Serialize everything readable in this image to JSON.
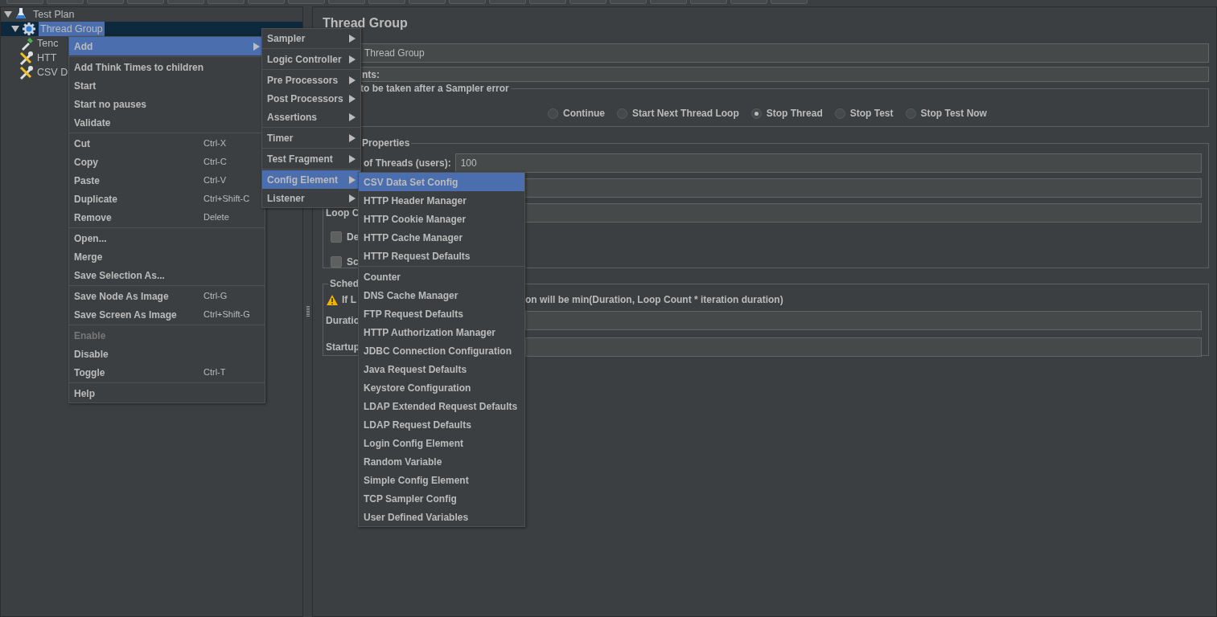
{
  "tree": [
    {
      "label": "Test Plan",
      "kind": "plan",
      "expanded": true,
      "selected": false,
      "children": [
        {
          "label": "Thread Group",
          "kind": "threads",
          "expanded": true,
          "selected": true,
          "children": [
            {
              "label": "Tenc",
              "kind": "dropper",
              "selected": false
            },
            {
              "label": "HTT",
              "kind": "tool",
              "selected": false
            },
            {
              "label": "CSV D",
              "kind": "tool",
              "selected": false
            }
          ]
        }
      ]
    }
  ],
  "editor": {
    "title": "Thread Group",
    "name_value": "Thread Group",
    "comments_label": "nts:",
    "error_action": {
      "legend": "to be taken after a Sampler error",
      "options": [
        {
          "label": "Continue",
          "selected": false
        },
        {
          "label": "Start Next Thread Loop",
          "selected": false
        },
        {
          "label": "Stop Thread",
          "selected": true
        },
        {
          "label": "Stop Test",
          "selected": false
        },
        {
          "label": "Stop Test Now",
          "selected": false
        }
      ]
    },
    "thread_properties": {
      "legend": "Properties",
      "threads_label": "of Threads (users):",
      "threads_value": "100",
      "loop_label": "Loop C",
      "checkboxes": [
        {
          "label": "De",
          "checked": false
        },
        {
          "label": "Sc",
          "checked": false
        }
      ]
    },
    "scheduler": {
      "legend": "Sched",
      "warning_start": "If L",
      "warning_end": "on will be min(Duration, Loop Count * iteration duration)",
      "fields": [
        {
          "label": "Duratio"
        },
        {
          "label": "Startup"
        }
      ]
    }
  },
  "context_menu": {
    "groups": [
      [
        {
          "label": "Add",
          "submenu": true,
          "selected": true,
          "disabled": false
        }
      ],
      [
        {
          "label": "Add Think Times to children",
          "selected": false,
          "disabled": false
        },
        {
          "label": "Start",
          "selected": false,
          "disabled": false
        },
        {
          "label": "Start no pauses",
          "selected": false,
          "disabled": false
        },
        {
          "label": "Validate",
          "selected": false,
          "disabled": false
        }
      ],
      [
        {
          "label": "Cut",
          "shortcut": "Ctrl-X",
          "selected": false,
          "disabled": false
        },
        {
          "label": "Copy",
          "shortcut": "Ctrl-C",
          "selected": false,
          "disabled": false
        },
        {
          "label": "Paste",
          "shortcut": "Ctrl-V",
          "selected": false,
          "disabled": false
        },
        {
          "label": "Duplicate",
          "shortcut": "Ctrl+Shift-C",
          "selected": false,
          "disabled": false
        },
        {
          "label": "Remove",
          "shortcut": "Delete",
          "selected": false,
          "disabled": false
        }
      ],
      [
        {
          "label": "Open...",
          "selected": false,
          "disabled": false
        },
        {
          "label": "Merge",
          "selected": false,
          "disabled": false
        },
        {
          "label": "Save Selection As...",
          "selected": false,
          "disabled": false
        }
      ],
      [
        {
          "label": "Save Node As Image",
          "shortcut": "Ctrl-G",
          "selected": false,
          "disabled": false
        },
        {
          "label": "Save Screen As Image",
          "shortcut": "Ctrl+Shift-G",
          "selected": false,
          "disabled": false
        }
      ],
      [
        {
          "label": "Enable",
          "selected": false,
          "disabled": true
        },
        {
          "label": "Disable",
          "selected": false,
          "disabled": false
        },
        {
          "label": "Toggle",
          "shortcut": "Ctrl-T",
          "selected": false,
          "disabled": false
        }
      ],
      [
        {
          "label": "Help",
          "selected": false,
          "disabled": false
        }
      ]
    ]
  },
  "add_submenu": {
    "groups": [
      [
        {
          "label": "Sampler",
          "selected": false
        }
      ],
      [
        {
          "label": "Logic Controller",
          "selected": false
        }
      ],
      [
        {
          "label": "Pre Processors",
          "selected": false
        },
        {
          "label": "Post Processors",
          "selected": false
        },
        {
          "label": "Assertions",
          "selected": false
        }
      ],
      [
        {
          "label": "Timer",
          "selected": false
        }
      ],
      [
        {
          "label": "Test Fragment",
          "selected": false
        }
      ],
      [
        {
          "label": "Config Element",
          "selected": true
        },
        {
          "label": "Listener",
          "selected": false
        }
      ]
    ]
  },
  "config_submenu": {
    "groups": [
      [
        {
          "label": "CSV Data Set Config",
          "selected": true
        },
        {
          "label": "HTTP Header Manager",
          "selected": false
        },
        {
          "label": "HTTP Cookie Manager",
          "selected": false
        },
        {
          "label": "HTTP Cache Manager",
          "selected": false
        },
        {
          "label": "HTTP Request Defaults",
          "selected": false
        }
      ],
      [
        {
          "label": "Counter",
          "selected": false
        },
        {
          "label": "DNS Cache Manager",
          "selected": false
        },
        {
          "label": "FTP Request Defaults",
          "selected": false
        },
        {
          "label": "HTTP Authorization Manager",
          "selected": false
        },
        {
          "label": "JDBC Connection Configuration",
          "selected": false
        },
        {
          "label": "Java Request Defaults",
          "selected": false
        },
        {
          "label": "Keystore Configuration",
          "selected": false
        },
        {
          "label": "LDAP Extended Request Defaults",
          "selected": false
        },
        {
          "label": "LDAP Request Defaults",
          "selected": false
        },
        {
          "label": "Login Config Element",
          "selected": false
        },
        {
          "label": "Random Variable",
          "selected": false
        },
        {
          "label": "Simple Config Element",
          "selected": false
        },
        {
          "label": "TCP Sampler Config",
          "selected": false
        },
        {
          "label": "User Defined Variables",
          "selected": false
        }
      ]
    ]
  }
}
